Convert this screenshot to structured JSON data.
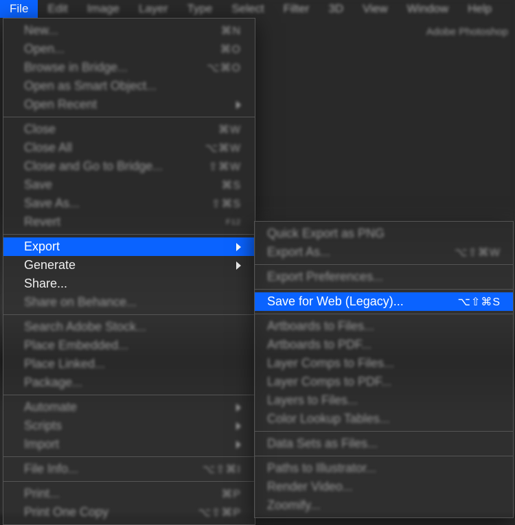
{
  "app": {
    "name": "Adobe Photoshop"
  },
  "menubar": {
    "items": [
      {
        "label": "File",
        "active": true
      },
      {
        "label": "Edit"
      },
      {
        "label": "Image"
      },
      {
        "label": "Layer"
      },
      {
        "label": "Type"
      },
      {
        "label": "Select"
      },
      {
        "label": "Filter"
      },
      {
        "label": "3D"
      },
      {
        "label": "View"
      },
      {
        "label": "Window"
      },
      {
        "label": "Help"
      }
    ]
  },
  "file_menu": {
    "new": {
      "label": "New...",
      "shortcut": "⌘N"
    },
    "open": {
      "label": "Open...",
      "shortcut": "⌘O"
    },
    "browse_bridge": {
      "label": "Browse in Bridge...",
      "shortcut": "⌥⌘O"
    },
    "open_smart": {
      "label": "Open as Smart Object..."
    },
    "open_recent": {
      "label": "Open Recent"
    },
    "close": {
      "label": "Close",
      "shortcut": "⌘W"
    },
    "close_all": {
      "label": "Close All",
      "shortcut": "⌥⌘W"
    },
    "close_bridge": {
      "label": "Close and Go to Bridge...",
      "shortcut": "⇧⌘W"
    },
    "save": {
      "label": "Save",
      "shortcut": "⌘S"
    },
    "save_as": {
      "label": "Save As...",
      "shortcut": "⇧⌘S"
    },
    "revert": {
      "label": "Revert",
      "shortcut": "F12"
    },
    "export": {
      "label": "Export"
    },
    "generate": {
      "label": "Generate"
    },
    "share": {
      "label": "Share..."
    },
    "share_behance": {
      "label": "Share on Behance..."
    },
    "search_stock": {
      "label": "Search Adobe Stock..."
    },
    "place_embedded": {
      "label": "Place Embedded..."
    },
    "place_linked": {
      "label": "Place Linked..."
    },
    "package": {
      "label": "Package..."
    },
    "automate": {
      "label": "Automate"
    },
    "scripts": {
      "label": "Scripts"
    },
    "import": {
      "label": "Import"
    },
    "file_info": {
      "label": "File Info...",
      "shortcut": "⌥⇧⌘I"
    },
    "print": {
      "label": "Print...",
      "shortcut": "⌘P"
    },
    "print_one": {
      "label": "Print One Copy",
      "shortcut": "⌥⇧⌘P"
    }
  },
  "export_menu": {
    "quick_export": {
      "label": "Quick Export as PNG"
    },
    "export_as": {
      "label": "Export As...",
      "shortcut": "⌥⇧⌘W"
    },
    "export_prefs": {
      "label": "Export Preferences..."
    },
    "save_for_web": {
      "label": "Save for Web (Legacy)...",
      "shortcut": "⌥⇧⌘S"
    },
    "artboards_files": {
      "label": "Artboards to Files..."
    },
    "artboards_pdf": {
      "label": "Artboards to PDF..."
    },
    "layer_comps_files": {
      "label": "Layer Comps to Files..."
    },
    "layer_comps_pdf": {
      "label": "Layer Comps to PDF..."
    },
    "layers_files": {
      "label": "Layers to Files..."
    },
    "color_lookup": {
      "label": "Color Lookup Tables..."
    },
    "data_sets": {
      "label": "Data Sets as Files..."
    },
    "paths_illustrator": {
      "label": "Paths to Illustrator..."
    },
    "render_video": {
      "label": "Render Video..."
    },
    "zoomify": {
      "label": "Zoomify..."
    }
  }
}
